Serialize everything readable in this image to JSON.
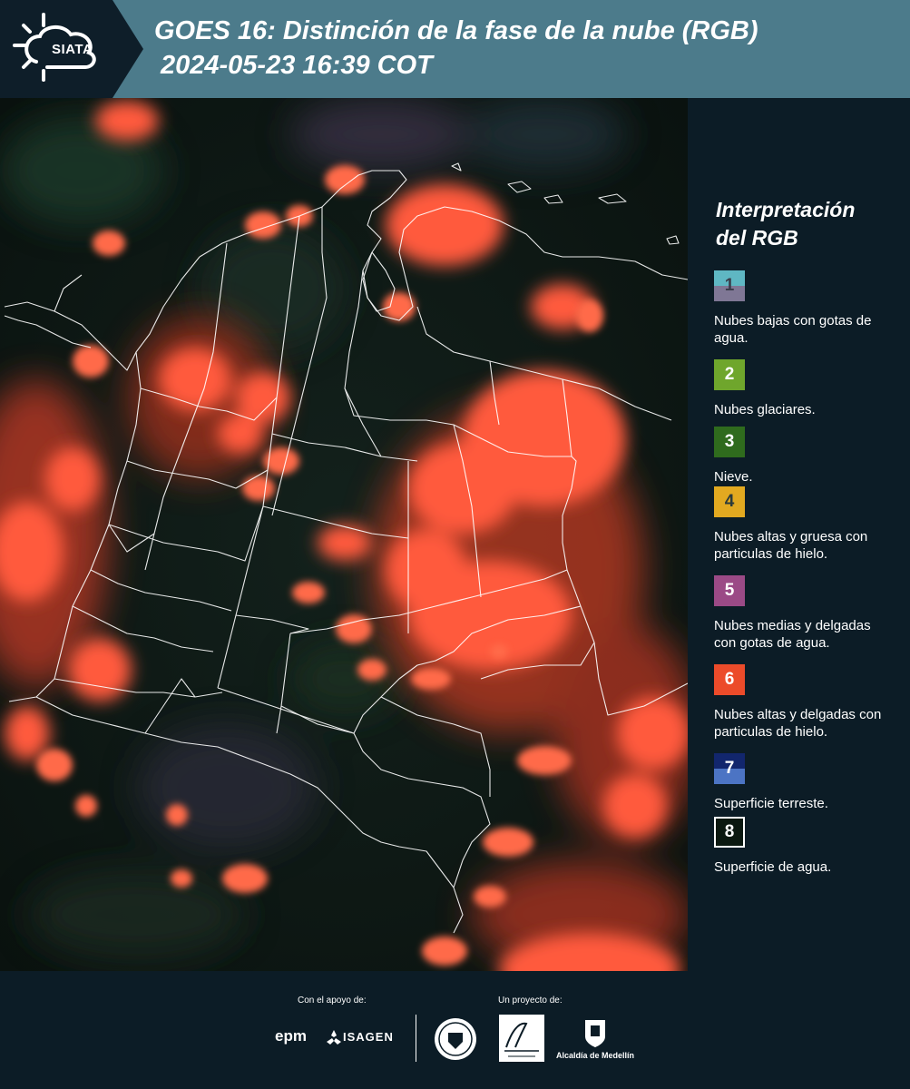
{
  "header": {
    "logo_text": "SIATA",
    "title_line1": "GOES 16: Distinción de la fase de la nube (RGB)",
    "title_line2": "2024-05-23 16:39 COT"
  },
  "legend": {
    "title_line1": "Interpretación",
    "title_line2": "del RGB",
    "items": [
      {
        "num": "1",
        "label": "Nubes bajas con gotas de agua.",
        "color_top": "#5fb7c3",
        "color_bottom": "#7f7795"
      },
      {
        "num": "2",
        "label": "Nubes glaciares.",
        "color_top": "#6fa62c",
        "color_bottom": "#6fa62c"
      },
      {
        "num": "3",
        "label": "Nieve.",
        "color_top": "#2f6b1d",
        "color_bottom": "#2f6b1d"
      },
      {
        "num": "4",
        "label": "Nubes altas y gruesa con particulas de hielo.",
        "color_top": "#e2a920",
        "color_bottom": "#e2a920"
      },
      {
        "num": "5",
        "label": "Nubes medias y delgadas con gotas de agua.",
        "color_top": "#9b4a86",
        "color_bottom": "#9b4a86"
      },
      {
        "num": "6",
        "label": "Nubes altas y delgadas con particulas de hielo.",
        "color_top": "#ec4b2a",
        "color_bottom": "#ec4b2a"
      },
      {
        "num": "7",
        "label": "Superficie terreste.",
        "color_top": "#12266d",
        "color_bottom": "#4c74c4"
      },
      {
        "num": "8",
        "label": "Superficie de agua.",
        "color_top": "#0b1810",
        "color_bottom": "#0b1810"
      }
    ]
  },
  "footer": {
    "support_label": "Con el apoyo de:",
    "project_label": "Un proyecto de:",
    "sponsor1": "epm",
    "sponsor2": "ISAGEN",
    "partner_name": "Alcaldía de Medellín"
  },
  "colors": {
    "header_bg": "#4c7b8b",
    "panel_bg": "#0c1c26",
    "cloud_red": "#ff5a3c"
  }
}
